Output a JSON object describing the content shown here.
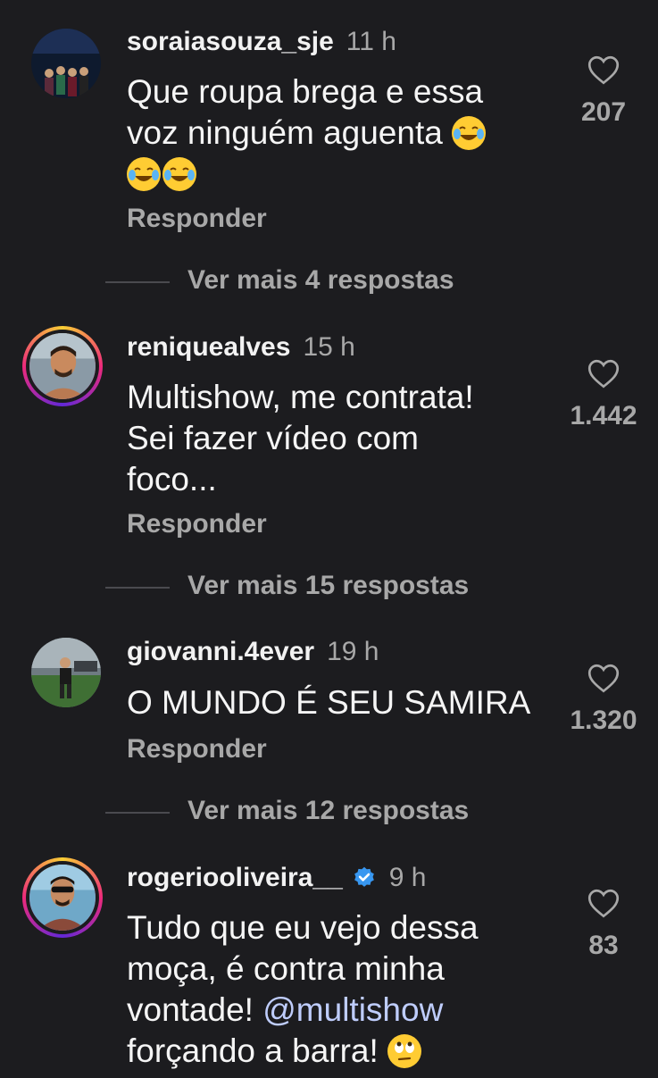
{
  "comments": [
    {
      "username": "soraiasouza_sje",
      "time": "11 h",
      "text1": "Que roupa brega e essa",
      "text2": "voz ninguém aguenta",
      "reply": "Responder",
      "likes": "207",
      "more": "Ver mais 4 respostas"
    },
    {
      "username": "reniquealves",
      "time": "15 h",
      "text1": "Multishow, me contrata!",
      "text2": "Sei fazer vídeo com",
      "text3": "foco...",
      "reply": "Responder",
      "likes": "1.442",
      "more": "Ver mais 15 respostas"
    },
    {
      "username": "giovanni.4ever",
      "time": "19 h",
      "text1": "O MUNDO É SEU SAMIRA",
      "reply": "Responder",
      "likes": "1.320",
      "more": "Ver mais 12 respostas"
    },
    {
      "username": "rogeriooliveira__",
      "time": "9 h",
      "text1": "Tudo que eu vejo dessa",
      "text2": "moça, é contra minha",
      "text3": "vontade! ",
      "mention": "@multishow",
      "text4": "forçando a barra!",
      "likes": "83"
    }
  ],
  "icons": {
    "like": "heart-outline-icon",
    "laugh": "face-with-tears-of-joy-emoji",
    "eyeroll": "face-with-rolling-eyes-emoji",
    "verified": "verified-badge-icon"
  },
  "colors": {
    "background": "#1c1c1f",
    "muted": "#a8a8a8",
    "mention": "#bfcdfc",
    "verified": "#3897f0"
  }
}
